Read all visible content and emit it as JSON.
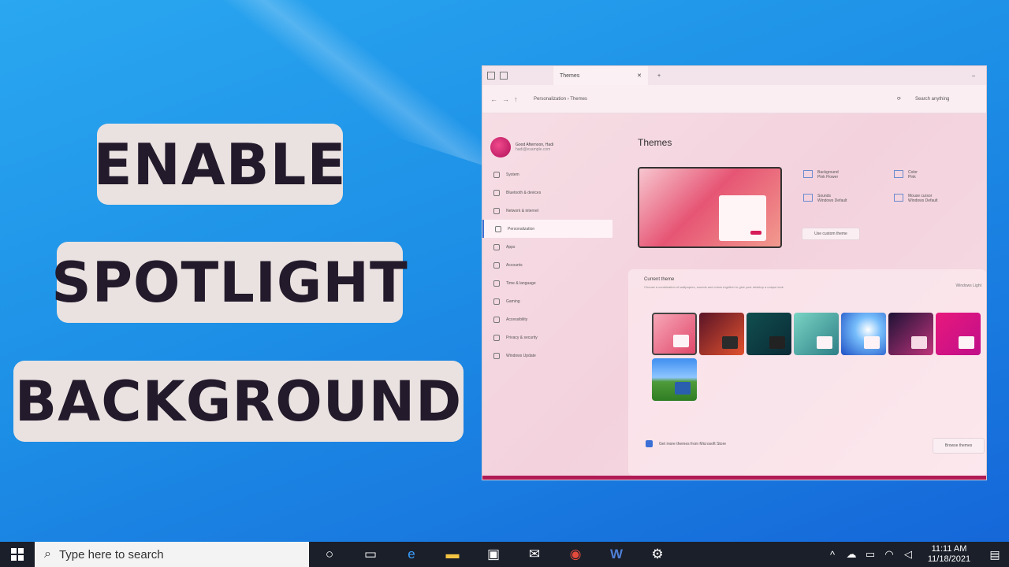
{
  "title": {
    "line1": "ENABLE",
    "line2": "SPOTLIGHT",
    "line3": "BACKGROUND"
  },
  "settings_window": {
    "tab_title": "Themes",
    "breadcrumb": "Personalization  ›  Themes",
    "search_placeholder": "Search anything",
    "user_name": "Good Afternoon, Hadi",
    "user_email": "hadi@example.com",
    "sidebar": [
      {
        "label": "System"
      },
      {
        "label": "Bluetooth & devices"
      },
      {
        "label": "Network & internet"
      },
      {
        "label": "Personalization"
      },
      {
        "label": "Apps"
      },
      {
        "label": "Accounts"
      },
      {
        "label": "Time & language"
      },
      {
        "label": "Gaming"
      },
      {
        "label": "Accessibility"
      },
      {
        "label": "Privacy & security"
      },
      {
        "label": "Windows Update"
      }
    ],
    "page_title": "Themes",
    "properties": {
      "background": "Background",
      "background_value": "Pink Flower",
      "color": "Color",
      "color_value": "Pink",
      "sounds": "Sounds",
      "sounds_value": "Windows Default",
      "cursor": "Mouse cursor",
      "cursor_value": "Windows Default"
    },
    "use_custom_button": "Use custom theme",
    "current_theme_label": "Current theme",
    "current_theme_desc": "Choose a combination of wallpapers, sounds and colors together to give your desktop a unique look",
    "current_theme_value": "Windows Light",
    "get_more": "Get more themes from Microsoft Store",
    "browse_button": "Browse themes"
  },
  "taskbar": {
    "search_placeholder": "Type here to search",
    "time": "11:11 AM",
    "date": "11/18/2021"
  },
  "colors": {
    "title_box_bg": "#e9e2e0",
    "title_text": "#231a2b",
    "accent": "#b11b55"
  }
}
